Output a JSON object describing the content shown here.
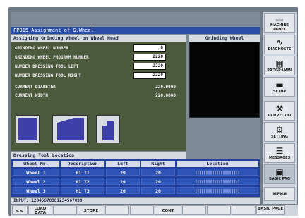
{
  "title": "FP815-Assignment of G.Wheel",
  "left_header": "Assigning Grinding Wheel on Wheel Head",
  "right_header": "Grinding Wheel",
  "params": [
    {
      "label": "GRINDING WHEEL NUMBER",
      "value": "0"
    },
    {
      "label": "GRINDING WHEEL PROGRAM NUMBER",
      "value": "2220"
    },
    {
      "label": "NUMBER DRESSING TOOL LEFT",
      "value": "2220"
    },
    {
      "label": "NUMBER DRESSING TOOL RIGHT",
      "value": "2220"
    }
  ],
  "readouts": [
    {
      "label": "CURRENT DIAMETER",
      "value": "220.0000"
    },
    {
      "label": "CURRENT WIDTH",
      "value": "220.0000"
    }
  ],
  "dressing_header": "Dressing Tool Location",
  "table": {
    "headers": [
      "Wheel No.",
      "Description",
      "Left",
      "Right",
      "Location"
    ],
    "rows": [
      [
        "Wheel 1",
        "H1 T1",
        "20",
        "20",
        "|||||||||||||||||||||"
      ],
      [
        "Wheel 2",
        "H1 T2",
        "20",
        "20",
        "|||||||||||||||||||||"
      ],
      [
        "Wheel 3",
        "H1 T3",
        "20",
        "20",
        "|||||||||||||||||||||"
      ]
    ]
  },
  "input_line": "INPUT: 12345678901234567890",
  "sidebar": [
    {
      "label": "MACHINE PANEL",
      "icon": "panel-icon"
    },
    {
      "label": "DIAGNOSTS",
      "icon": "pulse-icon"
    },
    {
      "label": "PROGRAMMI",
      "icon": "program-icon"
    },
    {
      "label": "SETUP",
      "icon": "setup-icon"
    },
    {
      "label": "CORRECTIO",
      "icon": "wrench-icon"
    },
    {
      "label": "SETTING",
      "icon": "gear-icon"
    },
    {
      "label": "MESSAGES",
      "icon": "list-icon"
    },
    {
      "label": "BASIC PAG",
      "icon": "monitor-icon"
    },
    {
      "label": "MENU",
      "icon": ""
    }
  ],
  "softkeys": {
    "back": "<<",
    "load": "LOAD DATA",
    "store": "STORE",
    "cont": "CONT",
    "basic_page": "BASIC PAGE"
  }
}
